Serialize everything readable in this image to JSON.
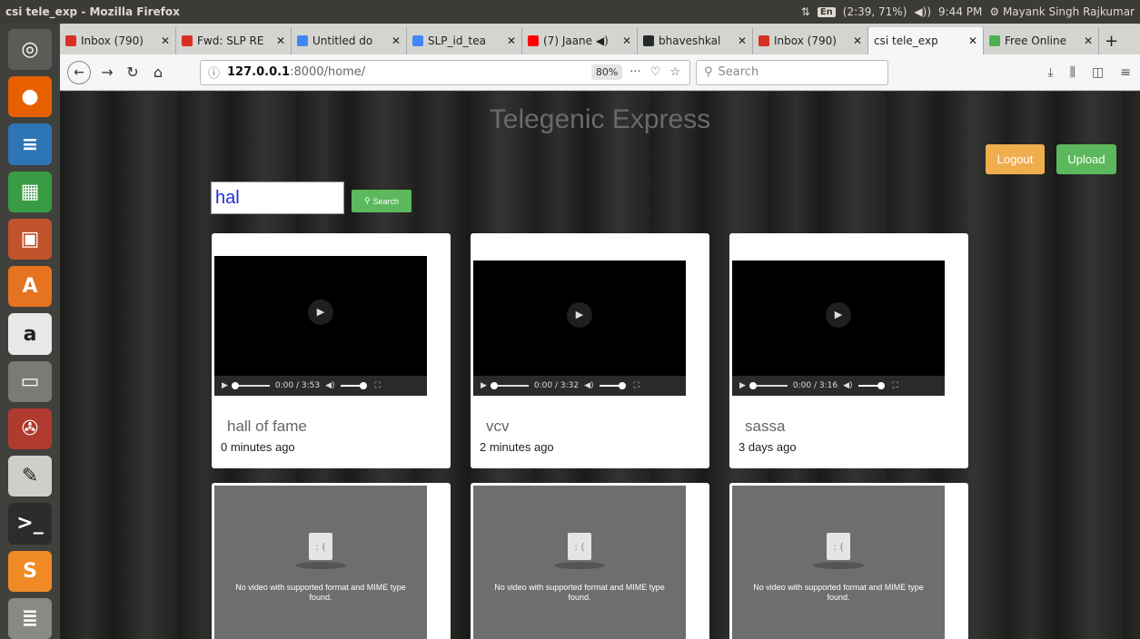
{
  "os": {
    "window_title": "csi tele_exp - Mozilla Firefox",
    "tray": {
      "network": "⇅",
      "lang": "En",
      "battery": "(2:39, 71%)",
      "volume": "◀))",
      "time": "9:44 PM",
      "user": "Mayank Singh Rajkumar"
    }
  },
  "launcher": [
    {
      "name": "ubuntu-dash-icon",
      "glyph": "◎",
      "color": "#5b5b57"
    },
    {
      "name": "firefox-icon",
      "glyph": "●",
      "color": "#e66000"
    },
    {
      "name": "writer-icon",
      "glyph": "≡",
      "color": "#2e75b6"
    },
    {
      "name": "calc-icon",
      "glyph": "▦",
      "color": "#3a9b45"
    },
    {
      "name": "impress-icon",
      "glyph": "▣",
      "color": "#c1532c"
    },
    {
      "name": "software-center-icon",
      "glyph": "A",
      "color": "#e6731f"
    },
    {
      "name": "amazon-icon",
      "glyph": "a",
      "color": "#e8e8e8"
    },
    {
      "name": "files-icon",
      "glyph": "▭",
      "color": "#7b7b75"
    },
    {
      "name": "settings-icon",
      "glyph": "✇",
      "color": "#b03a2e"
    },
    {
      "name": "text-editor-icon",
      "glyph": "✎",
      "color": "#cfcfca"
    },
    {
      "name": "terminal-icon",
      "glyph": ">_",
      "color": "#2c2c2c"
    },
    {
      "name": "sublime-icon",
      "glyph": "S",
      "color": "#f08a24"
    },
    {
      "name": "stack-icon",
      "glyph": "≣",
      "color": "#8a8a85"
    }
  ],
  "tabs": [
    {
      "label": "Inbox (790)",
      "color": "#d93025",
      "active": false,
      "w": 128
    },
    {
      "label": "Fwd: SLP RE",
      "color": "#d93025",
      "active": false,
      "w": 127
    },
    {
      "label": "Untitled do",
      "color": "#4285f4",
      "active": false,
      "w": 127
    },
    {
      "label": "SLP_id_tea",
      "color": "#4285f4",
      "active": false,
      "w": 127
    },
    {
      "label": "(7) Jaane ◀)",
      "color": "#ff0000",
      "active": false,
      "w": 127
    },
    {
      "label": "bhaveshkal",
      "color": "#24292e",
      "active": false,
      "w": 127
    },
    {
      "label": "Inbox (790)",
      "color": "#d93025",
      "active": false,
      "w": 127
    },
    {
      "label": "csi tele_exp",
      "color": "",
      "active": true,
      "w": 127
    },
    {
      "label": "Free Online",
      "color": "#4caf50",
      "active": false,
      "w": 127
    }
  ],
  "nav": {
    "url_host": "127.0.0.1",
    "url_path": ":8000/home/",
    "zoom": "80%",
    "search_placeholder": "Search"
  },
  "site": {
    "title": "Telegenic Express",
    "logout": "Logout",
    "upload": "Upload",
    "query": "hal",
    "search_btn": "Search"
  },
  "videos": [
    {
      "title": "hall of fame",
      "time": "0 minutes ago",
      "duration": "0:00 / 3:53"
    },
    {
      "title": "vcv",
      "time": "2 minutes ago",
      "duration": "0:00 / 3:32"
    },
    {
      "title": "sassa",
      "time": "3 days ago",
      "duration": "0:00 / 3:16"
    }
  ],
  "broken_msg": "No video with supported format and MIME type found."
}
